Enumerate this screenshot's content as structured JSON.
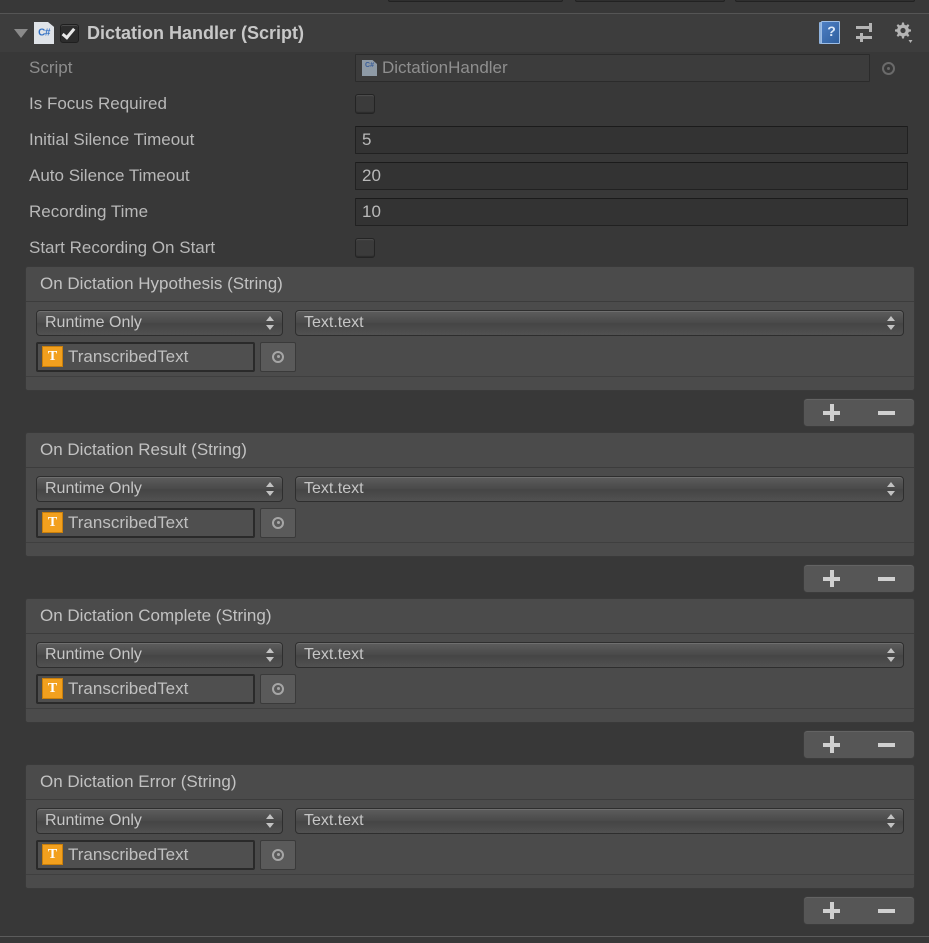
{
  "component": {
    "title": "Dictation Handler (Script)",
    "foldout_icon": "triangle-down-icon",
    "script_type_icon": "csharp-script-icon",
    "script_type_label": "C#",
    "enabled": true,
    "header_icons": [
      {
        "name": "help-icon",
        "glyph": "?"
      },
      {
        "name": "preset-icon",
        "glyph": "sliders"
      },
      {
        "name": "settings-gear-icon",
        "glyph": "gear"
      }
    ]
  },
  "properties": [
    {
      "label": "Script",
      "type": "object",
      "value": "DictationHandler",
      "icon": "csharp-script-icon",
      "readonly": true
    },
    {
      "label": "Is Focus Required",
      "type": "checkbox",
      "checked": false
    },
    {
      "label": "Initial Silence Timeout",
      "type": "number",
      "value": "5"
    },
    {
      "label": "Auto Silence Timeout",
      "type": "number",
      "value": "20"
    },
    {
      "label": "Recording Time",
      "type": "number",
      "value": "10"
    },
    {
      "label": "Start Recording On Start",
      "type": "checkbox",
      "checked": false
    }
  ],
  "events": [
    {
      "title": "On Dictation Hypothesis (String)",
      "listener": {
        "mode": "Runtime Only",
        "method": "Text.text",
        "object": "TranscribedText",
        "object_icon": "ui-text-component-icon",
        "object_icon_letter": "T"
      },
      "add_label": "+",
      "remove_label": "−"
    },
    {
      "title": "On Dictation Result (String)",
      "listener": {
        "mode": "Runtime Only",
        "method": "Text.text",
        "object": "TranscribedText",
        "object_icon": "ui-text-component-icon",
        "object_icon_letter": "T"
      },
      "add_label": "+",
      "remove_label": "−"
    },
    {
      "title": "On Dictation Complete (String)",
      "listener": {
        "mode": "Runtime Only",
        "method": "Text.text",
        "object": "TranscribedText",
        "object_icon": "ui-text-component-icon",
        "object_icon_letter": "T"
      },
      "add_label": "+",
      "remove_label": "−"
    },
    {
      "title": "On Dictation Error (String)",
      "listener": {
        "mode": "Runtime Only",
        "method": "Text.text",
        "object": "TranscribedText",
        "object_icon": "ui-text-component-icon",
        "object_icon_letter": "T"
      },
      "add_label": "+",
      "remove_label": "−"
    }
  ],
  "colors": {
    "background": "#383838",
    "header_bg": "#3d3d3d",
    "event_bg": "#4b4b4b",
    "label_text": "#b8b8b8",
    "accent_orange": "#f2a01e",
    "help_blue": "#4d7fc4"
  }
}
